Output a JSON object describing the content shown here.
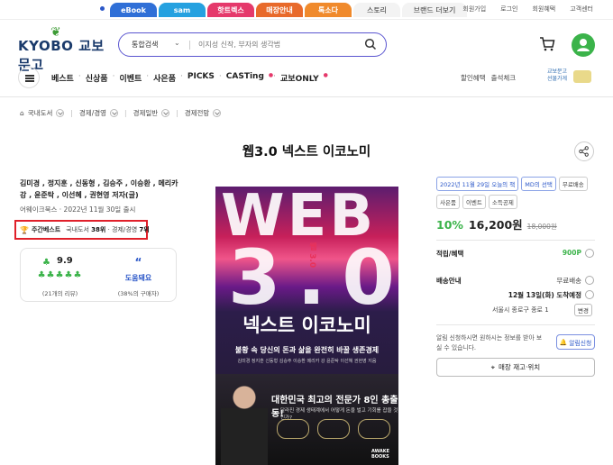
{
  "topbar": {
    "tabs": [
      {
        "label": "eBook",
        "color": "#2f6fd7"
      },
      {
        "label": "sam",
        "color": "#25a1e0"
      },
      {
        "label": "핫트렉스",
        "color": "#e5396b"
      },
      {
        "label": "매장안내",
        "color": "#e86a2b"
      },
      {
        "label": "톡소다",
        "color": "#f08a2c"
      },
      {
        "label": "스토리"
      },
      {
        "label": "브랜드 더보기"
      }
    ],
    "links": [
      "회원가입",
      "로그인",
      "회원혜택",
      "고객센터"
    ]
  },
  "header": {
    "logo_text": "KYOBO 교보문고",
    "search_category": "통합검색",
    "search_placeholder": "이지성 신작, 부자의 생각법"
  },
  "nav": {
    "items": [
      "베스트",
      "신상품",
      "이벤트",
      "사은품",
      "PICKS",
      "CASTing",
      "교보ONLY"
    ],
    "right_links": [
      "할인혜택",
      "출석체크"
    ],
    "gift_label_1": "교보문고",
    "gift_label_2": "선물가게"
  },
  "breadcrumb": [
    "국내도서",
    "경제/경영",
    "경제일반",
    "경제전망"
  ],
  "product": {
    "title": "웹3.0 넥스트 이코노미",
    "authors": "김미경 , 정지훈 , 신동형 , 김승주 , 이승환 , 메리카 강 , 윤준탁 , 이선혜 , 권현영 저자(글)",
    "publisher_date": "어웨이크북스 · 2022년 11월 30일 출시",
    "bestseller": {
      "label": "주간베스트",
      "prefix": "국내도서",
      "rank1": "38위",
      "category": "· 경제/경영",
      "rank2": "7위"
    },
    "rating": {
      "score": "9.9",
      "reviews": "(21개의 리뷰)",
      "help_label": "도움돼요",
      "help_pct": "(38%의 구매자)"
    }
  },
  "cover": {
    "web": "WEB",
    "num": "3.0",
    "small_vertical": "웹 3.0",
    "title": "넥스트 이코노미",
    "subtitle": "불황 속 당신의 돈과 삶을 완전히 바꿀 생존경제",
    "authors_line": "김미경 정지훈 신동형 김승주 이승환 메리카 강 윤준탁 이선혜 권현영 지음",
    "headline": "대한민국 최고의 전문가 8인 총출동!",
    "headline2": "달라진 경제 생태계에서 어떻게 돈을 벌고 기회를 잡을 것인가?",
    "brand": "AWAKE BOOKS"
  },
  "side": {
    "badges": [
      "2022년 11월 29일 오늘의 책",
      "MD의 선택",
      "무료배송",
      "사은품",
      "이벤트",
      "소득공제"
    ],
    "discount": "10%",
    "price": "16,200원",
    "original_price": "18,000원",
    "points_label": "적립/혜택",
    "points_value": "900P",
    "shipping_label": "배송안내",
    "shipping_free": "무료배송",
    "shipping_date": "12월 13일(화) 도착예정",
    "shipping_addr": "서울시 종로구 종로 1",
    "change_label": "변경",
    "alert_text": "알림 신청하시면 원하시는 정보를 받아 보실 수 있습니다.",
    "alert_button": "알림신청",
    "store_button": "매장 재고·위치"
  }
}
